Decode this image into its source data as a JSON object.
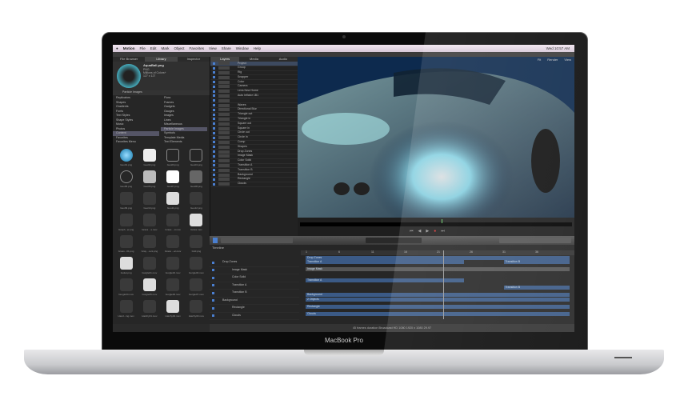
{
  "device": {
    "brand": "MacBook Pro"
  },
  "menubar": {
    "items": [
      "Motion",
      "File",
      "Edit",
      "Mark",
      "Object",
      "Favorites",
      "View",
      "Share",
      "Window",
      "Help"
    ],
    "clock": "Wed 10:57 AM"
  },
  "left_tabs": [
    "File Browser",
    "Library",
    "Inspector"
  ],
  "preview": {
    "name": "AquaBall.png",
    "type": "PNG",
    "colors": "Millions of Colors+",
    "size": "127 x 127"
  },
  "library": {
    "path": "Particle Images",
    "categories": [
      "Replicators",
      "Shapes",
      "Gradients",
      "Fonts",
      "Text Styles",
      "Shape Styles",
      "Music",
      "Photos",
      "Content",
      "Favorites",
      "Favorites Menu"
    ],
    "selected_category": "Content",
    "folders": [
      "Flora",
      "Frames",
      "Gadgets",
      "Gauges",
      "Images",
      "Lines",
      "Miscellaneous",
      "Particle Images",
      "Symbols",
      "Template Media",
      "Text Elements"
    ],
    "selected_folder": "Particle Images",
    "items": [
      "Geo01.png",
      "Geo02.png",
      "Geo03.png",
      "Geo04.png",
      "Geo05.png",
      "Geo06.png",
      "Geo07.png",
      "Geo08.png",
      "Geo09.png",
      "Geo10.png",
      "Geo11.png",
      "Geo12.png",
      "Graph...er.png",
      "Grass ...s.mov",
      "Grass ...d.mov",
      "Grass.mov",
      "Grass...01.png",
      "Gray ...ient.png",
      "Grass ...ar.mov",
      "Grid.png",
      "Guitar.png",
      "Gurgle01.mov",
      "Gurgle02.mov",
      "Gurgle03.mov",
      "Gurgle04.mov",
      "Gurgle05.mov",
      "Gurgle06.mov",
      "Gurgle07.mov",
      "Hand...ing.mov",
      "Hatchy01.mov",
      "Hatchy02.mov",
      "Hatchy03.mov"
    ]
  },
  "project_tabs": [
    "Layers",
    "Media",
    "Audio"
  ],
  "layers": [
    "Project",
    "Group",
    "Rig",
    "Snapper",
    "Color",
    "Camera",
    "Lens New Home",
    "Auto Inflator 1B1",
    "",
    "Waves",
    "Directional Blur",
    "Triangle out",
    "Triangle in",
    "Square out",
    "Square in",
    "Circle out",
    "Circle in",
    "Comp",
    "Shapes",
    "Drop Zones",
    "Image Mask",
    "Color Solid",
    "Transition A",
    "Transition B",
    "Background",
    "Rectangle",
    "Clouds"
  ],
  "canvas_toolbar": {
    "fit": "Fit",
    "render": "Render",
    "view": "View"
  },
  "timeline": {
    "title": "Timeline",
    "ruler": [
      "1",
      "6",
      "11",
      "16",
      "21",
      "26",
      "31",
      "36"
    ],
    "rows": [
      "Drop Zones",
      "Image Mask",
      "Color Solid",
      "Transition A",
      "Transition B",
      "Background",
      "Rectangle",
      "Clouds"
    ],
    "tracks": [
      "Drop Zones",
      "Transition A",
      "Transition B",
      "Image Mask",
      "Transition A",
      "Transition B",
      "Background",
      "2 Objects",
      "Rectangle",
      "Clouds"
    ]
  },
  "status": "45 frames duration Broadcast HD 1080 1920 x 1080 29.97",
  "colors": {
    "accent": "#3b5a86",
    "bezel": "#0b0b0b",
    "panel": "#262626"
  }
}
